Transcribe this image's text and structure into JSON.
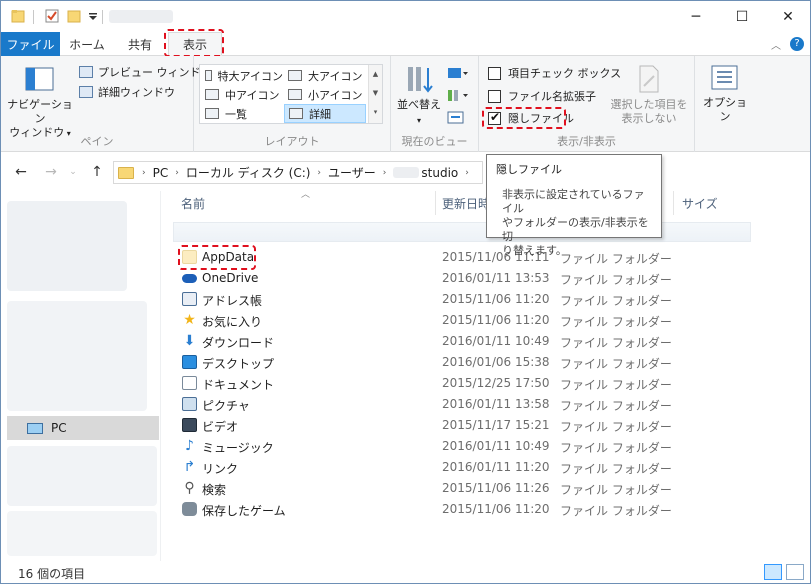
{
  "tabs": {
    "file": "ファイル",
    "home": "ホーム",
    "share": "共有",
    "view": "表示"
  },
  "ribbon": {
    "panes": {
      "nav_pane_line1": "ナビゲーション",
      "nav_pane_line2": "ウィンドウ",
      "preview": "プレビュー ウィンドウ",
      "details": "詳細ウィンドウ",
      "label": "ペイン"
    },
    "layout": {
      "items": [
        "特大アイコン",
        "大アイコン",
        "中アイコン",
        "小アイコン",
        "一覧",
        "詳細"
      ],
      "selected": "詳細",
      "label": "レイアウト"
    },
    "current_view": {
      "sort": "並べ替え",
      "label": "現在のビュー"
    },
    "show_hide": {
      "item_checkboxes": "項目チェック ボックス",
      "file_extensions": "ファイル名拡張子",
      "hidden_items": "隠しファイル",
      "hidden_items_checked": true,
      "hide_selected_line1": "選択した項目を",
      "hide_selected_line2": "表示しない",
      "label": "表示/非表示"
    },
    "options": "オプション"
  },
  "address": {
    "crumbs": [
      "PC",
      "ローカル ディスク (C:)",
      "ユーザー",
      "studio"
    ]
  },
  "tooltip": {
    "title": "隠しファイル",
    "body_line1": "非表示に設定されているファイル",
    "body_line2": "やフォルダーの表示/非表示を切",
    "body_line3": "り替えます。"
  },
  "columns": {
    "name": "名前",
    "modified": "更新日時",
    "size": "サイズ"
  },
  "navpane": {
    "pc": "PC"
  },
  "files": [
    {
      "name": "AppData",
      "date": "2015/11/06 11:11",
      "type": "ファイル フォルダー",
      "icon": "folder-hidden-icon"
    },
    {
      "name": "OneDrive",
      "date": "2016/01/11 13:53",
      "type": "ファイル フォルダー",
      "icon": "onedrive-icon"
    },
    {
      "name": "アドレス帳",
      "date": "2015/11/06 11:20",
      "type": "ファイル フォルダー",
      "icon": "contacts-icon"
    },
    {
      "name": "お気に入り",
      "date": "2015/11/06 11:20",
      "type": "ファイル フォルダー",
      "icon": "favorites-star-icon"
    },
    {
      "name": "ダウンロード",
      "date": "2016/01/11 10:49",
      "type": "ファイル フォルダー",
      "icon": "download-arrow-icon"
    },
    {
      "name": "デスクトップ",
      "date": "2016/01/06 15:38",
      "type": "ファイル フォルダー",
      "icon": "desktop-icon"
    },
    {
      "name": "ドキュメント",
      "date": "2015/12/25 17:50",
      "type": "ファイル フォルダー",
      "icon": "documents-icon"
    },
    {
      "name": "ピクチャ",
      "date": "2016/01/11 13:58",
      "type": "ファイル フォルダー",
      "icon": "pictures-icon"
    },
    {
      "name": "ビデオ",
      "date": "2015/11/17 15:21",
      "type": "ファイル フォルダー",
      "icon": "videos-icon"
    },
    {
      "name": "ミュージック",
      "date": "2016/01/11 10:49",
      "type": "ファイル フォルダー",
      "icon": "music-note-icon"
    },
    {
      "name": "リンク",
      "date": "2016/01/11 11:20",
      "type": "ファイル フォルダー",
      "icon": "links-arrow-icon"
    },
    {
      "name": "検索",
      "date": "2015/11/06 11:26",
      "type": "ファイル フォルダー",
      "icon": "search-magnifier-icon"
    },
    {
      "name": "保存したゲーム",
      "date": "2015/11/06 11:20",
      "type": "ファイル フォルダー",
      "icon": "saved-games-icon"
    }
  ],
  "status": {
    "count": "16 個の項目"
  },
  "colors": {
    "file_tab": "#1979ca",
    "highlight_outline": "#e0101e",
    "selection": "#cce8ff"
  }
}
